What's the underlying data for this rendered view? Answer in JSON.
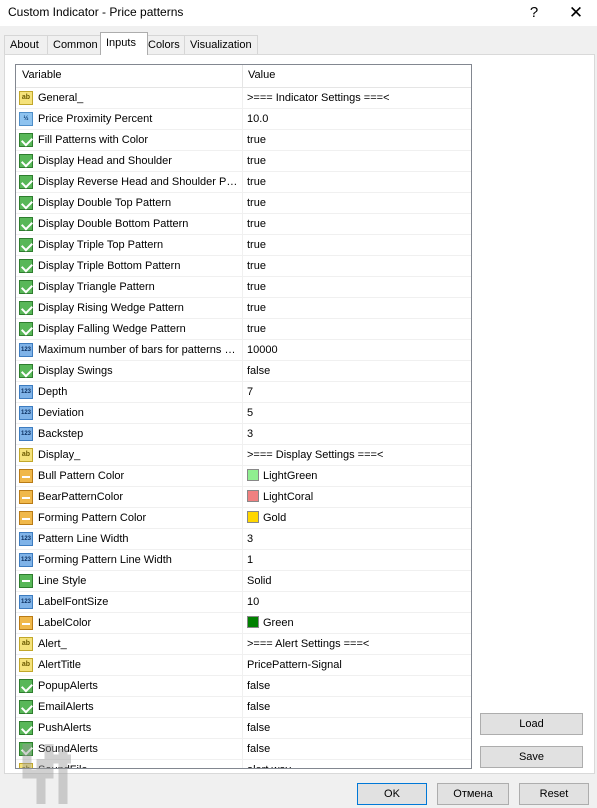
{
  "window": {
    "title": "Custom Indicator - Price patterns",
    "help": "?",
    "close": "✕"
  },
  "tabs": [
    {
      "label": "About",
      "active": false
    },
    {
      "label": "Common",
      "active": false
    },
    {
      "label": "Inputs",
      "active": true
    },
    {
      "label": "Colors",
      "active": false
    },
    {
      "label": "Visualization",
      "active": false
    }
  ],
  "grid": {
    "col_variable": "Variable",
    "col_value": "Value",
    "rows": [
      {
        "icon": "ab",
        "name": "General_",
        "value": ">=== Indicator Settings ===<"
      },
      {
        "icon": "num",
        "name": "Price Proximity Percent",
        "value": "10.0"
      },
      {
        "icon": "bool",
        "name": "Fill Patterns with Color",
        "value": "true"
      },
      {
        "icon": "bool",
        "name": "Display Head and Shoulder",
        "value": "true"
      },
      {
        "icon": "bool",
        "name": "Display Reverse Head and Shoulder Pat...",
        "value": "true"
      },
      {
        "icon": "bool",
        "name": "Display Double Top Pattern",
        "value": "true"
      },
      {
        "icon": "bool",
        "name": "Display Double Bottom Pattern",
        "value": "true"
      },
      {
        "icon": "bool",
        "name": "Display Triple Top Pattern",
        "value": "true"
      },
      {
        "icon": "bool",
        "name": "Display Triple Bottom Pattern",
        "value": "true"
      },
      {
        "icon": "bool",
        "name": "Display Triangle Pattern",
        "value": "true"
      },
      {
        "icon": "bool",
        "name": "Display Rising Wedge Pattern",
        "value": "true"
      },
      {
        "icon": "bool",
        "name": "Display Falling Wedge Pattern",
        "value": "true"
      },
      {
        "icon": "int",
        "name": "Maximum number of bars for patterns se...",
        "value": "10000"
      },
      {
        "icon": "bool",
        "name": "Display Swings",
        "value": "false"
      },
      {
        "icon": "int",
        "name": "Depth",
        "value": "7"
      },
      {
        "icon": "int",
        "name": "Deviation",
        "value": "5"
      },
      {
        "icon": "int",
        "name": "Backstep",
        "value": "3"
      },
      {
        "icon": "ab",
        "name": "Display_",
        "value": ">=== Display Settings ===<"
      },
      {
        "icon": "col",
        "name": "Bull Pattern Color",
        "value": "LightGreen",
        "swatch": "#90ee90"
      },
      {
        "icon": "col",
        "name": "BearPatternColor",
        "value": "LightCoral",
        "swatch": "#f08080"
      },
      {
        "icon": "col",
        "name": "Forming Pattern Color",
        "value": "Gold",
        "swatch": "#ffd700"
      },
      {
        "icon": "int",
        "name": "Pattern Line Width",
        "value": "3"
      },
      {
        "icon": "int",
        "name": "Forming Pattern Line Width",
        "value": "1"
      },
      {
        "icon": "sty",
        "name": "Line Style",
        "value": "Solid"
      },
      {
        "icon": "int",
        "name": "LabelFontSize",
        "value": "10"
      },
      {
        "icon": "col",
        "name": "LabelColor",
        "value": "Green",
        "swatch": "#008000"
      },
      {
        "icon": "ab",
        "name": "Alert_",
        "value": ">=== Alert Settings ===<"
      },
      {
        "icon": "ab",
        "name": "AlertTitle",
        "value": "PricePattern-Signal"
      },
      {
        "icon": "bool",
        "name": "PopupAlerts",
        "value": "false"
      },
      {
        "icon": "bool",
        "name": "EmailAlerts",
        "value": "false"
      },
      {
        "icon": "bool",
        "name": "PushAlerts",
        "value": "false"
      },
      {
        "icon": "bool",
        "name": "SoundAlerts",
        "value": "false"
      },
      {
        "icon": "ab",
        "name": "SoundFile",
        "value": "alert.wav"
      }
    ]
  },
  "buttons": {
    "load": "Load",
    "save": "Save",
    "ok": "OK",
    "cancel": "Отмена",
    "reset": "Reset"
  },
  "colors": {
    "accent": "#0078d7",
    "border": "#adadad"
  }
}
